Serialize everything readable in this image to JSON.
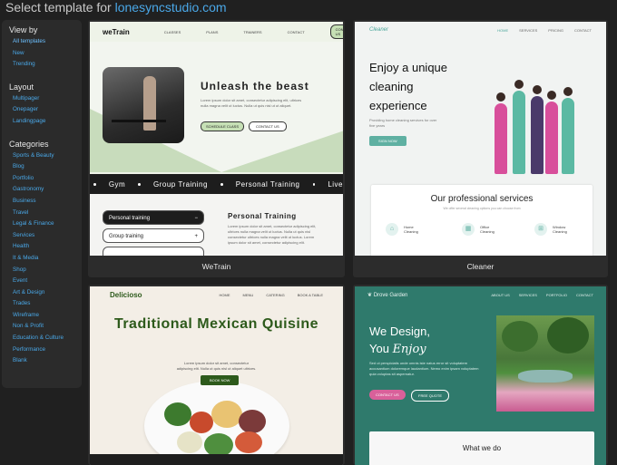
{
  "header": {
    "prefix": "Select template for",
    "domain": "lonesyncstudio.com"
  },
  "sidebar": {
    "view_by": {
      "title": "View by",
      "items": [
        "All templates",
        "New",
        "Trending"
      ]
    },
    "layout": {
      "title": "Layout",
      "items": [
        "Multipager",
        "Onepager",
        "Landingpage"
      ]
    },
    "categories": {
      "title": "Categories",
      "items": [
        "Sports & Beauty",
        "Blog",
        "Portfolio",
        "Gastronomy",
        "Business",
        "Travel",
        "Legal & Finance",
        "Services",
        "Health",
        "It & Media",
        "Shop",
        "Event",
        "Art & Design",
        "Trades",
        "Wireframe",
        "Non & Profit",
        "Education & Culture",
        "Performance",
        "Blank"
      ]
    }
  },
  "templates": {
    "wetrain": {
      "caption": "WeTrain",
      "logo": "weTrain",
      "nav": [
        "CLASSES",
        "PLANS",
        "TRAINERS",
        "CONTACT"
      ],
      "cta": "CONTACT US",
      "hero_title": "Unleash the beast",
      "hero_text": "Lorem ipsum dolor sit amet, consectetur adipiscing elit, ultrices nulla magna velit ut luctus. Nulla ut quis nisl ut ut aliquet.",
      "btn_primary": "SCHEDULE CLASS",
      "btn_secondary": "CONTACT US",
      "strip": [
        "Gym",
        "Group Training",
        "Personal Training",
        "Live"
      ],
      "pills": [
        "Personal training",
        "Group training"
      ],
      "section_title": "Personal Training",
      "section_text": "Lorem ipsum dolor sit amet, consectetur adipiscing elit, ultrices nulla magna velit ut luctus. Nulla ut quis nisl consectetur ultrices nulla magna velit ut luctus. Lorem ipsum dolor sit amet, consectetur adipiscing elit."
    },
    "cleaner": {
      "caption": "Cleaner",
      "logo": "Cleaner",
      "nav": [
        "HOME",
        "SERVICES",
        "PRICING",
        "CONTACT"
      ],
      "hero_title": "Enjoy a unique cleaning experience",
      "hero_text": "Providing home cleaning services for over five years",
      "btn": "SIGN NOW",
      "services_title": "Our professional services",
      "services_text": "We offer several cleaning options you can choose from",
      "services": [
        "Home Cleaning",
        "Office Cleaning",
        "Window Cleaning"
      ]
    },
    "delicioso": {
      "logo": "Delicioso",
      "nav": [
        "HOME",
        "MENU",
        "CATERING",
        "BOOK A TABLE"
      ],
      "hero_title": "Traditional Mexican Quisine",
      "hero_text": "Lorem ipsum dolor sit amet, consectetur adipiscing elit. Nulla ut quis nisl ut aliquet ultrices.",
      "btn": "BOOK NOW"
    },
    "drove": {
      "logo": "Drove Garden",
      "nav": [
        "ABOUT US",
        "SERVICES",
        "PORTFOLIO",
        "CONTACT"
      ],
      "hero_line1": "We Design,",
      "hero_line2a": "You ",
      "hero_line2b": "Enjoy",
      "hero_text": "Sed ut perspiciatis unde omnis iste natus error sit voluptatem accusantium doloremque laudantium. Nemo enim ipsam voluptatem quia voluptas sit aspernatur.",
      "btn_primary": "CONTACT US",
      "btn_secondary": "FREE QUOTE",
      "section_title": "What we do"
    }
  }
}
